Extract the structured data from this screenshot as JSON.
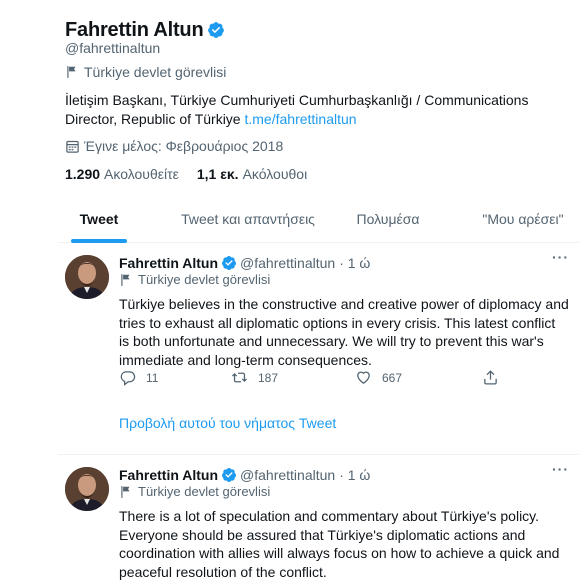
{
  "profile": {
    "display_name": "Fahrettin Altun",
    "handle": "@fahrettinaltun",
    "label": "Türkiye devlet görevlisi",
    "bio_text": "İletişim Başkanı, Türkiye Cumhuriyeti Cumhurbaşkanlığı / Communications Director, Republic of Türkiye ",
    "bio_link": "t.me/fahrettinaltun",
    "joined": "Έγινε μέλος: Φεβρουάριος 2018",
    "following_count": "1.290",
    "following_label": "Ακολουθείτε",
    "followers_count": "1,1 εκ.",
    "followers_label": "Ακόλουθοι"
  },
  "tabs": [
    {
      "label": "Tweet",
      "active": true
    },
    {
      "label": "Tweet και απαντήσεις",
      "active": false
    },
    {
      "label": "Πολυμέσα",
      "active": false
    },
    {
      "label": "\"Μου αρέσει\"",
      "active": false
    }
  ],
  "tweets": [
    {
      "name": "Fahrettin Altun",
      "handle": "@fahrettinaltun",
      "time": "· 1 ώ",
      "label": "Türkiye devlet görevlisi",
      "text": "Türkiye believes in the constructive and creative power of diplomacy and tries to exhaust all diplomatic options in every crisis. This latest conflict is both unfortunate and unnecessary. We will try to prevent this war's immediate and long-term consequences.",
      "replies": "11",
      "retweets": "187",
      "likes": "667",
      "thread_link": "Προβολή αυτού του νήματος Tweet",
      "more": "···"
    },
    {
      "name": "Fahrettin Altun",
      "handle": "@fahrettinaltun",
      "time": "· 1 ώ",
      "label": "Türkiye devlet görevlisi",
      "text": "There is a lot of speculation and commentary about Türkiye's policy. Everyone should be assured that Türkiye's diplomatic actions and coordination with allies will always focus on how to achieve a quick and peaceful resolution of the conflict.",
      "more": "···"
    }
  ],
  "colors": {
    "accent": "#1d9bf0",
    "muted": "#536471",
    "text": "#0f1419",
    "border": "#eff3f4"
  },
  "icons": [
    "verified-badge-icon",
    "flag-icon",
    "calendar-icon",
    "more-icon",
    "reply-icon",
    "retweet-icon",
    "like-icon",
    "share-icon"
  ]
}
